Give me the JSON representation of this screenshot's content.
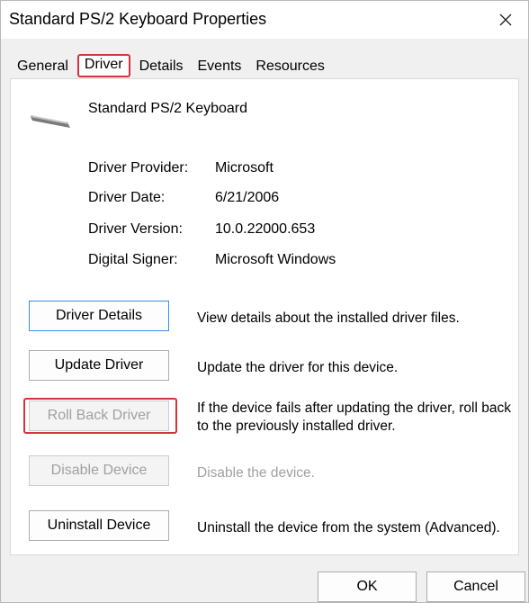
{
  "window": {
    "title": "Standard PS/2 Keyboard Properties"
  },
  "tabs": [
    {
      "label": "General"
    },
    {
      "label": "Driver",
      "active": true
    },
    {
      "label": "Details"
    },
    {
      "label": "Events"
    },
    {
      "label": "Resources"
    }
  ],
  "device": {
    "name": "Standard PS/2 Keyboard",
    "icon": "keyboard-icon"
  },
  "properties": [
    {
      "label": "Driver Provider:",
      "value": "Microsoft"
    },
    {
      "label": "Driver Date:",
      "value": "6/21/2006"
    },
    {
      "label": "Driver Version:",
      "value": "10.0.22000.653"
    },
    {
      "label": "Digital Signer:",
      "value": "Microsoft Windows"
    }
  ],
  "actions": [
    {
      "label": "Driver Details",
      "description": "View details about the installed driver files.",
      "enabled": true
    },
    {
      "label": "Update Driver",
      "description": "Update the driver for this device.",
      "enabled": true
    },
    {
      "label": "Roll Back Driver",
      "description": "If the device fails after updating the driver, roll back to the previously installed driver.",
      "enabled": false
    },
    {
      "label": "Disable Device",
      "description": "Disable the device.",
      "enabled": false
    },
    {
      "label": "Uninstall Device",
      "description": "Uninstall the device from the system (Advanced).",
      "enabled": true
    }
  ],
  "footer": {
    "ok_label": "OK",
    "cancel_label": "Cancel"
  },
  "colors": {
    "highlight": "#d0343c",
    "focus": "#3a8ee6",
    "disabled_text": "#a0a0a0"
  }
}
